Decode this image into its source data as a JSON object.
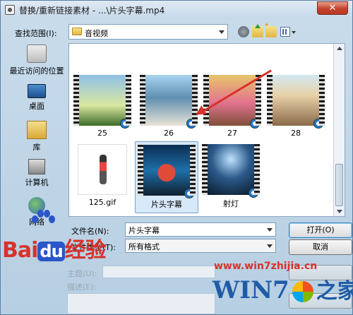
{
  "window": {
    "title": "替换/重新链接素材 - ...\\片头字幕.mp4",
    "close_label": "✕"
  },
  "lookin": {
    "label": "查找范围(I):",
    "value": "音视频"
  },
  "places": [
    {
      "label": "最近访问的位置",
      "icon": "recent-places-icon"
    },
    {
      "label": "桌面",
      "icon": "desktop-icon"
    },
    {
      "label": "库",
      "icon": "library-icon"
    },
    {
      "label": "计算机",
      "icon": "computer-icon"
    },
    {
      "label": "网络",
      "icon": "network-icon"
    }
  ],
  "files": [
    {
      "label": "25"
    },
    {
      "label": "26"
    },
    {
      "label": "27"
    },
    {
      "label": "28"
    },
    {
      "label": "125.gif"
    },
    {
      "label": "片头字幕"
    },
    {
      "label": "射灯"
    }
  ],
  "form": {
    "filename_label": "文件名(N):",
    "filename_value": "片头字幕",
    "filetype_label": "文件类型(T):",
    "filetype_value": "所有格式",
    "open_label": "打开(O)",
    "cancel_label": "取消",
    "subject_label": "主题(U):",
    "desc_label": "描述(E):"
  },
  "watermarks": {
    "baidu_a": "Bai",
    "baidu_du": "du",
    "baidu_b": "经验",
    "win7_url": "www.win7zhijia.cn",
    "win7_text": "WIN7",
    "win7_home": "之家"
  }
}
